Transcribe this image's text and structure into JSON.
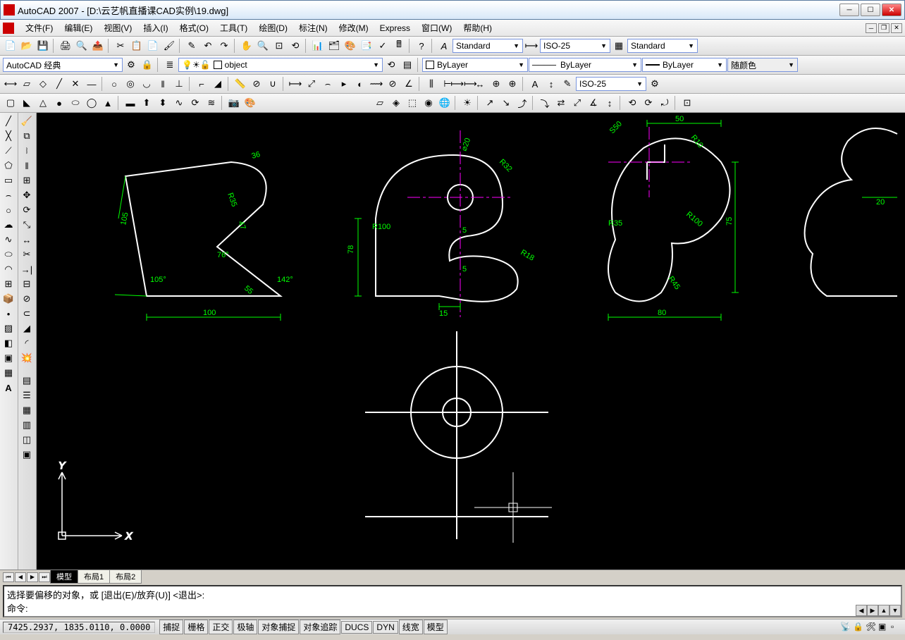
{
  "title": "AutoCAD 2007 - [D:\\云艺帆直播课CAD实例\\19.dwg]",
  "menu": {
    "file": "文件(F)",
    "edit": "编辑(E)",
    "view": "视图(V)",
    "insert": "插入(I)",
    "format": "格式(O)",
    "tools": "工具(T)",
    "draw": "绘图(D)",
    "dimension": "标注(N)",
    "modify": "修改(M)",
    "express": "Express",
    "window": "窗口(W)",
    "help": "帮助(H)"
  },
  "toolbar1": {
    "workspace": "AutoCAD 经典",
    "layer": "object",
    "textstyle": "Standard",
    "dimstyle": "ISO-25",
    "tablestyle": "Standard"
  },
  "toolbar2": {
    "props_layer": "ByLayer",
    "props_ltype": "ByLayer",
    "props_lweight": "ByLayer",
    "props_color": "随颜色",
    "dim_current": "ISO-25"
  },
  "tabs": {
    "model": "模型",
    "layout1": "布局1",
    "layout2": "布局2"
  },
  "cmdline": {
    "line1": "选择要偏移的对象，或 [退出(E)/放弃(U)] <退出>:",
    "line2": "命令:"
  },
  "status": {
    "coords": "7425.2937, 1835.0110, 0.0000",
    "snap": "捕捉",
    "grid": "栅格",
    "ortho": "正交",
    "polar": "极轴",
    "osnap": "对象捕捉",
    "otrack": "对象追踪",
    "ducs": "DUCS",
    "dyn": "DYN",
    "lwt": "线宽",
    "model": "模型"
  },
  "dims": {
    "s1_100": "100",
    "s1_105": "105",
    "s1_105a": "105°",
    "s1_76": "76°",
    "s1_55": "55",
    "s1_142": "142°",
    "s1_36": "36",
    "s1_35": "R35",
    "s1_47": "47",
    "s2_78": "78",
    "s2_r100": "R100",
    "s2_15": "15",
    "s2_r32": "R32",
    "s2_r18": "R18",
    "s2_20": "⌀20",
    "s2_5a": "5",
    "s2_5b": "5",
    "s3_50": "50",
    "s3_80": "80",
    "s3_75": "75",
    "s3_r10": "R10",
    "s3_s50": "S50",
    "s3_r100": "R100",
    "s3_r35": "R35",
    "s3_r45": "R45",
    "s4_20": "20"
  },
  "ucs": {
    "x": "X",
    "y": "Y"
  }
}
